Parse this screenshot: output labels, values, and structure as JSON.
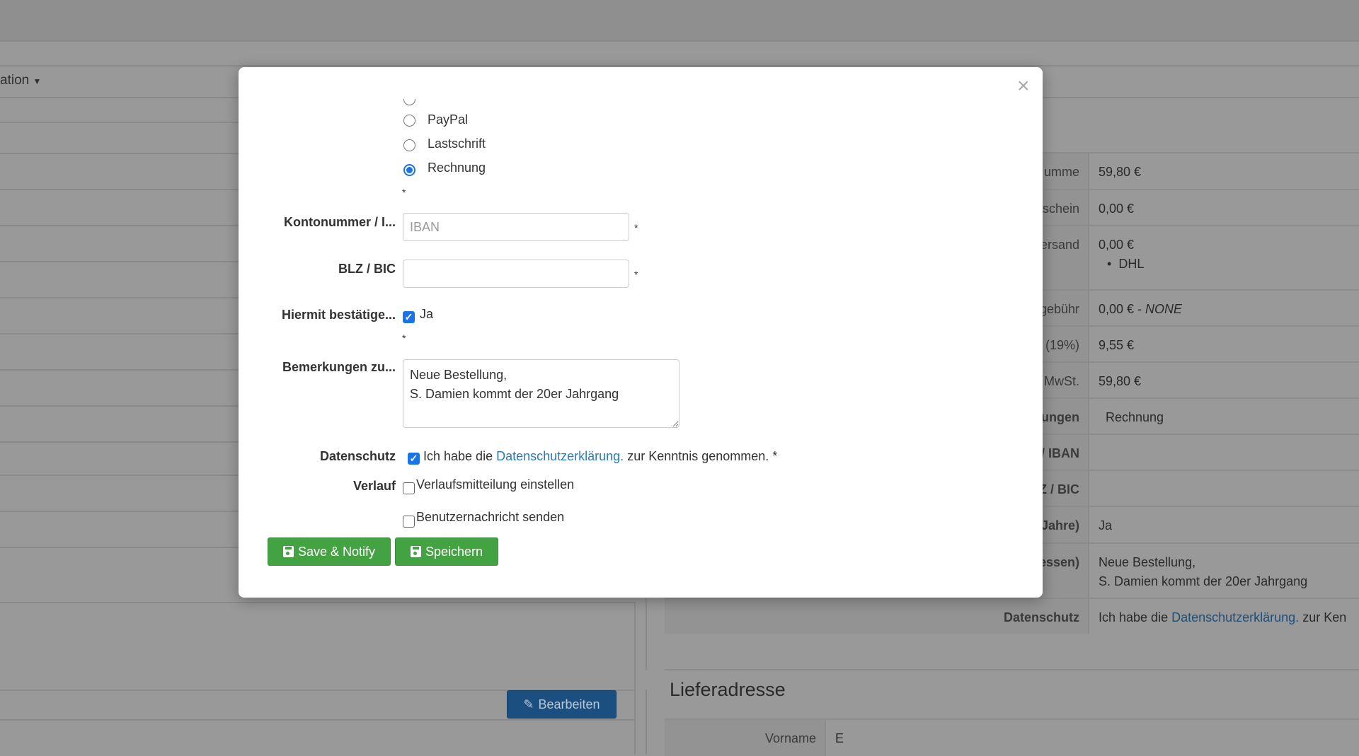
{
  "background": {
    "nav_dropdown": "ation",
    "right_table": [
      {
        "label": "umme",
        "value": "59,80 €"
      },
      {
        "label": "schein",
        "value": "0,00 €"
      },
      {
        "label": "ersand",
        "value": "0,00 €",
        "bullet": "DHL"
      },
      {
        "label": "gebühr",
        "value": "0,00 € - ",
        "value_em": "NONE"
      },
      {
        "label": "(19%)",
        "value": "9,55 €"
      },
      {
        "label": "MwSt.",
        "value": "59,80 €"
      },
      {
        "label": "ungen",
        "value": "Rechnung"
      },
      {
        "label": "/ IBAN",
        "value": ""
      },
      {
        "label": "Z / BIC",
        "value": ""
      },
      {
        "label": "Jahre)",
        "value": "Ja"
      },
      {
        "label": "essen)",
        "value": "Neue Bestellung,",
        "value2": "S. Damien kommt der 20er Jahrgang"
      },
      {
        "label": "Datenschutz",
        "value": "Ich habe die ",
        "link": "Datenschutzerklärung.",
        "after": " zur Ken"
      }
    ],
    "edit_button": "Bearbeiten",
    "delivery_legend": "Lieferadresse",
    "delivery_rows": [
      {
        "label": "Vorname",
        "value": "E"
      }
    ]
  },
  "modal": {
    "payment_options": [
      "PayPal",
      "Lastschrift",
      "Rechnung"
    ],
    "selected_payment": "Rechnung",
    "required_mark": "*",
    "iban_label": "Kontonummer / I...",
    "iban_placeholder": "IBAN",
    "iban_value": "",
    "bic_label": "BLZ / BIC",
    "bic_value": "",
    "confirm_label": "Hiermit bestätige...",
    "confirm_option": "Ja",
    "remarks_label": "Bemerkungen zu...",
    "remarks_value": "Neue Bestellung,\nS. Damien kommt der 20er Jahrgang",
    "privacy_label": "Datenschutz",
    "privacy_text_before": "Ich habe die ",
    "privacy_link": "Datenschutzerklärung.",
    "privacy_text_after": " zur Kenntnis genommen. *",
    "history_label": "Verlauf",
    "history_option1": "Verlaufsmitteilung einstellen",
    "history_option2": "Benutzernachricht senden",
    "save_notify_label": "Save & Notify",
    "save_label": "Speichern",
    "close_symbol": "×"
  },
  "colors": {
    "accent": "#1a73e8",
    "save": "#43a343",
    "edit": "#1b4f7f",
    "link": "#2a7ac0"
  }
}
